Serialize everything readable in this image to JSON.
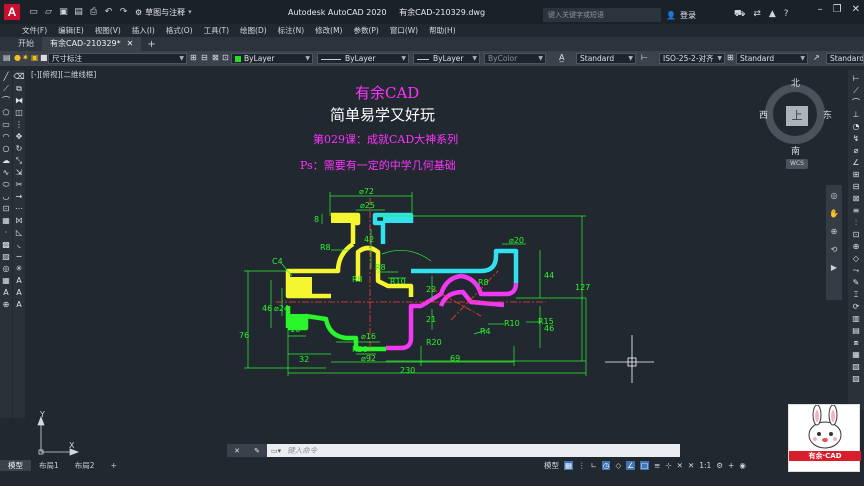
{
  "titlebar": {
    "workspace": "草图与注释",
    "app_title": "Autodesk AutoCAD 2020",
    "file_title": "有余CAD-210329.dwg",
    "search_placeholder": "键入关键字或短语",
    "login_label": "登录"
  },
  "menu": [
    "文件(F)",
    "编辑(E)",
    "视图(V)",
    "插入(I)",
    "格式(O)",
    "工具(T)",
    "绘图(D)",
    "标注(N)",
    "修改(M)",
    "参数(P)",
    "窗口(W)",
    "帮助(H)"
  ],
  "tabs": {
    "start": "开始",
    "doc": "有余CAD-210329*"
  },
  "properties": {
    "dim_style_layer": "尺寸标注",
    "color": "ByLayer",
    "linetype": "ByLayer",
    "lineweight": "ByLayer",
    "plotstyle": "ByColor",
    "text_style": "Standard",
    "dim_style": "ISO-25-2-对齐",
    "table_style": "Standard",
    "multileader_style": "Standard"
  },
  "viewport_label": "[-][俯视][二维线框]",
  "overlay": {
    "brand": "有余CAD",
    "slogan": "简单易学又好玩",
    "lesson": "第029课：成就CAD大神系列",
    "note": "Ps：需要有一定的中学几何基础"
  },
  "viewcube": {
    "north": "北",
    "south": "南",
    "east": "东",
    "west": "西",
    "top": "上",
    "wcs": "WCS"
  },
  "drawing": {
    "dims": {
      "d72": "⌀72",
      "d25": "⌀25",
      "d8": "8",
      "r8a": "R8",
      "d42": "42",
      "d20": "⌀20",
      "r8b": "R8",
      "r10a": "R10",
      "c4": "C4",
      "r8c": "R8",
      "d22": "22",
      "r8d": "R8",
      "d44": "44",
      "d127": "127",
      "r15": "R15",
      "d76": "76",
      "d46a": "46",
      "d24": "⌀24",
      "d21": "21",
      "r4": "R4",
      "r10b": "R10",
      "d46b": "46",
      "d16": "16",
      "r20a": "R20",
      "d16b": "⌀16",
      "r20b": "R20",
      "d32": "32",
      "d92": "⌀92",
      "d69": "69",
      "d230": "230",
      "ucs_x": "X",
      "ucs_y": "Y"
    }
  },
  "command": {
    "placeholder": "键入命令"
  },
  "layout_tabs": [
    "模型",
    "布局1",
    "布局2"
  ],
  "status": {
    "model": "模型",
    "scale": "1:1"
  },
  "logo": {
    "text": "有余·CAD"
  }
}
